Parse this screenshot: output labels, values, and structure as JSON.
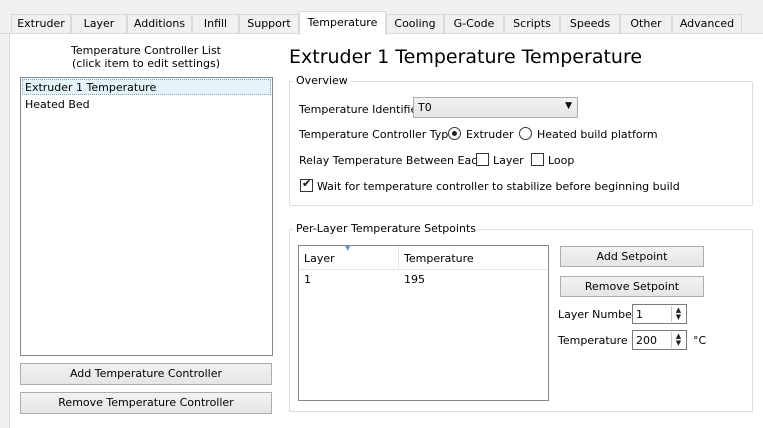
{
  "tabs": [
    "Extruder",
    "Layer",
    "Additions",
    "Infill",
    "Support",
    "Temperature",
    "Cooling",
    "G-Code",
    "Scripts",
    "Speeds",
    "Other",
    "Advanced"
  ],
  "active_tab": "Temperature",
  "controller_list": {
    "title_line1": "Temperature Controller List",
    "title_line2": "(click item to edit settings)",
    "items": [
      "Extruder 1 Temperature",
      "Heated Bed"
    ],
    "selected_index": 0,
    "add_button": "Add Temperature Controller",
    "remove_button": "Remove Temperature Controller"
  },
  "heading": "Extruder 1 Temperature Temperature",
  "overview": {
    "title": "Overview",
    "identifier_label": "Temperature Identifier",
    "identifier_value": "T0",
    "controller_type_label": "Temperature Controller Type:",
    "type_options": [
      "Extruder",
      "Heated build platform"
    ],
    "type_selected": "Extruder",
    "relay_label": "Relay Temperature Between Each:",
    "relay_layer": "Layer",
    "relay_layer_checked": false,
    "relay_loop": "Loop",
    "relay_loop_checked": false,
    "wait_label": "Wait for temperature controller to stabilize before beginning build",
    "wait_checked": true
  },
  "setpoints": {
    "title": "Per-Layer Temperature Setpoints",
    "columns": [
      "Layer",
      "Temperature"
    ],
    "rows": [
      [
        "1",
        "195"
      ]
    ],
    "add_button": "Add Setpoint",
    "remove_button": "Remove Setpoint",
    "layer_number_label": "Layer Number",
    "layer_number_value": "1",
    "temperature_label": "Temperature",
    "temperature_value": "200",
    "temperature_unit": "°C"
  }
}
